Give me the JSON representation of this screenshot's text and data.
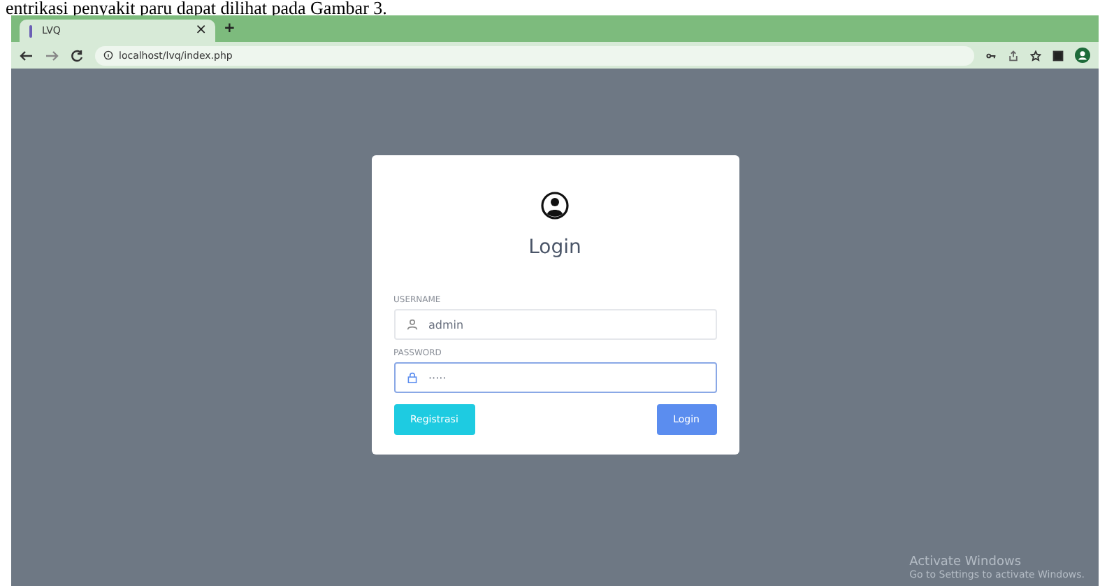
{
  "document_text": "entrikasi penyakit paru dapat dilihat pada Gambar 3.",
  "browser": {
    "tab": {
      "title": "LVQ",
      "close": "×"
    },
    "new_tab": "+",
    "url": "localhost/lvq/index.php"
  },
  "login": {
    "title": "Login",
    "fields": [
      {
        "kind": "user",
        "label": "USERNAME",
        "value": "admin",
        "focused": false
      },
      {
        "kind": "lock",
        "label": "PASSWORD",
        "value": "·····",
        "focused": true
      }
    ],
    "buttons": [
      {
        "label": "Registrasi",
        "kind": "secondary"
      },
      {
        "label": "Login",
        "kind": "primary"
      }
    ]
  },
  "activation": {
    "title": "Activate Windows",
    "subtitle": "Go to Settings to activate Windows."
  }
}
